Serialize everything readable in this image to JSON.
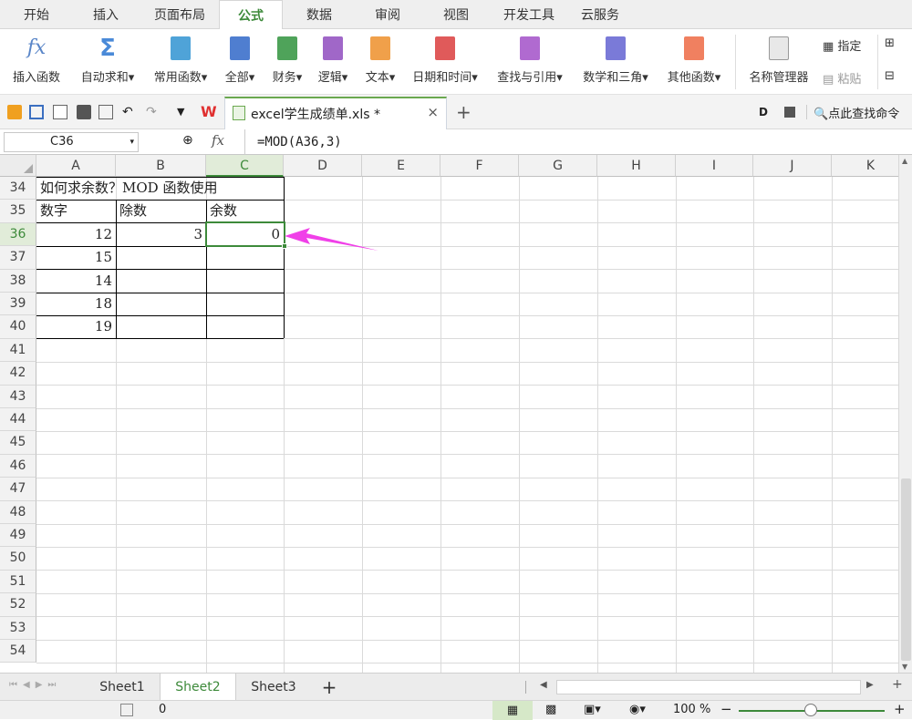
{
  "menu": {
    "items": [
      "开始",
      "插入",
      "页面布局",
      "公式",
      "数据",
      "审阅",
      "视图",
      "开发工具",
      "云服务"
    ],
    "active_index": 3
  },
  "ribbon": {
    "buttons": [
      {
        "label": "插入函数",
        "icon": "fx-icon"
      },
      {
        "label": "自动求和",
        "icon": "sigma-icon"
      },
      {
        "label": "常用函数",
        "icon": "star-book-icon"
      },
      {
        "label": "全部",
        "icon": "list-book-icon"
      },
      {
        "label": "财务",
        "icon": "money-book-icon"
      },
      {
        "label": "逻辑",
        "icon": "question-book-icon"
      },
      {
        "label": "文本",
        "icon": "text-book-icon"
      },
      {
        "label": "日期和时间",
        "icon": "clock-book-icon"
      },
      {
        "label": "查找与引用",
        "icon": "search-book-icon"
      },
      {
        "label": "数学和三角",
        "icon": "theta-book-icon"
      },
      {
        "label": "其他函数",
        "icon": "more-book-icon"
      },
      {
        "label": "名称管理器",
        "icon": "name-manager-icon"
      }
    ],
    "assign_label": "指定",
    "paste_label": "粘贴",
    "colors": {
      "accent": "#3d8a3a",
      "star": "#4fa3d8",
      "list": "#4f7ed0",
      "money": "#4fa35a",
      "question": "#a067c8",
      "text": "#f0a04a",
      "clock": "#e05a5a",
      "search": "#b06ad0",
      "theta": "#7a7ad8",
      "more": "#f08060"
    }
  },
  "tabs": {
    "file_name": "excel学生成绩单.xls *",
    "search_label": "点此查找命令"
  },
  "formula_bar": {
    "name_box": "C36",
    "fx_label": "fx",
    "formula": "=MOD(A36,3)"
  },
  "sheet": {
    "columns": [
      "A",
      "B",
      "C",
      "D",
      "E",
      "F",
      "G",
      "H",
      "I",
      "J",
      "K"
    ],
    "selected_column": "C",
    "rows": [
      34,
      35,
      36,
      37,
      38,
      39,
      40,
      41,
      42,
      43,
      44,
      45,
      46,
      47,
      48,
      49,
      50,
      51,
      52,
      53,
      54
    ],
    "selected_row": 36,
    "cells": {
      "r34": {
        "a": "如何求余数？MOD 函数使用"
      },
      "r35": {
        "a": "数字",
        "b": "除数",
        "c": "余数"
      },
      "r36": {
        "a": "12",
        "b": "3",
        "c": "0"
      },
      "r37": {
        "a": "15"
      },
      "r38": {
        "a": "14"
      },
      "r39": {
        "a": "18"
      },
      "r40": {
        "a": "19"
      }
    },
    "annotation_color": "#f040e8"
  },
  "sheet_tabs": {
    "tabs": [
      "Sheet1",
      "Sheet2",
      "Sheet3"
    ],
    "active": "Sheet2"
  },
  "status": {
    "value": "0",
    "zoom": "100 %"
  }
}
